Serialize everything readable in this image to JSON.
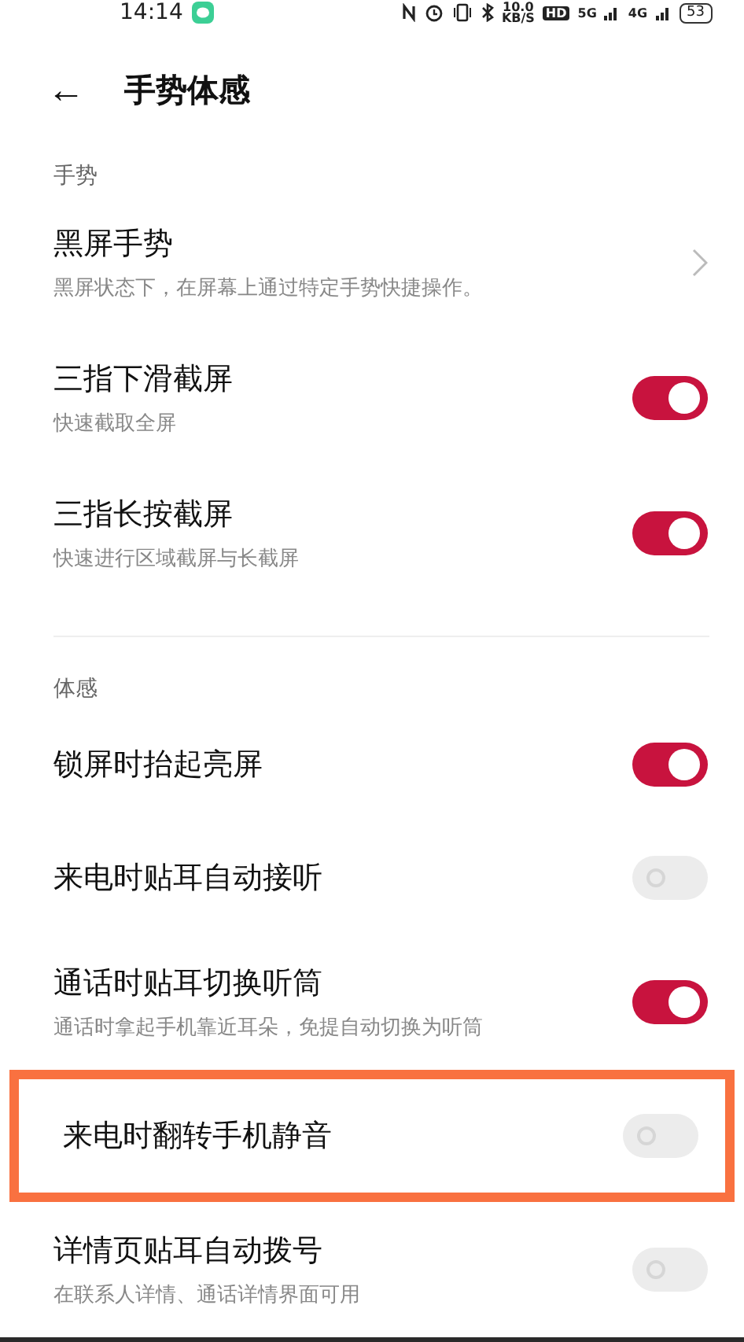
{
  "status_bar": {
    "time": "14:14",
    "speed_value": "10.0",
    "speed_unit": "KB/S",
    "hd": "HD",
    "network_1": "5G",
    "network_2": "4G",
    "battery": "53"
  },
  "header": {
    "back": "←",
    "title": "手势体感"
  },
  "sections": [
    {
      "title": "手势",
      "items": [
        {
          "kind": "link",
          "title": "黑屏手势",
          "subtitle": "黑屏状态下，在屏幕上通过特定手势快捷操作。",
          "highlighted": false
        },
        {
          "kind": "switch",
          "title": "三指下滑截屏",
          "subtitle": "快速截取全屏",
          "on": true,
          "highlighted": false
        },
        {
          "kind": "switch",
          "title": "三指长按截屏",
          "subtitle": "快速进行区域截屏与长截屏",
          "on": true,
          "highlighted": false
        }
      ]
    },
    {
      "title": "体感",
      "items": [
        {
          "kind": "switch",
          "title": "锁屏时抬起亮屏",
          "on": true,
          "highlighted": false
        },
        {
          "kind": "switch",
          "title": "来电时贴耳自动接听",
          "on": false,
          "highlighted": false
        },
        {
          "kind": "switch",
          "title": "通话时贴耳切换听筒",
          "subtitle": "通话时拿起手机靠近耳朵，免提自动切换为听筒",
          "on": true,
          "highlighted": false
        },
        {
          "kind": "switch",
          "title": "来电时翻转手机静音",
          "on": false,
          "highlighted": true
        },
        {
          "kind": "switch",
          "title": "详情页贴耳自动拨号",
          "subtitle": "在联系人详情、通话详情界面可用",
          "on": false,
          "highlighted": false
        }
      ]
    }
  ]
}
